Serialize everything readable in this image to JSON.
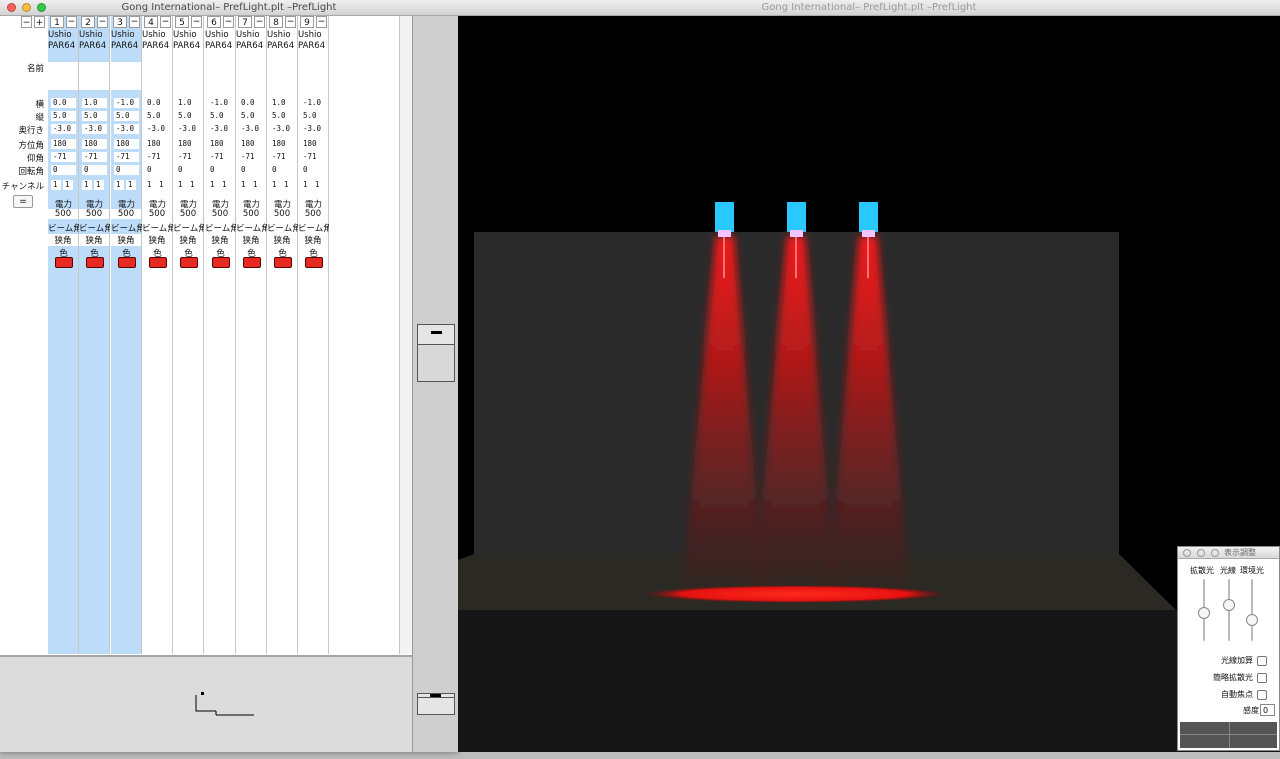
{
  "left_window": {
    "title": "Gong International– PrefLight.plt –PrefLight",
    "header_buttons": [
      "−",
      "+"
    ],
    "row_labels": [
      "名前",
      "横",
      "縦",
      "奥行き",
      "方位角",
      "仰角",
      "回転角",
      "チャンネル"
    ],
    "equal_button": "=",
    "power_label": "電力",
    "beam_label": "ビーム角",
    "narrow_label": "狭角",
    "color_label": "色",
    "fixtures": [
      {
        "num": "1",
        "brand": "Ushio",
        "model": "PAR64",
        "x": "0.0",
        "y": "5.0",
        "z": "-3.0",
        "azimuth": "180",
        "elevation": "-71",
        "rotation": "0",
        "channel": [
          "1",
          "1"
        ],
        "power": "500",
        "selected": true
      },
      {
        "num": "2",
        "brand": "Ushio",
        "model": "PAR64",
        "x": "1.0",
        "y": "5.0",
        "z": "-3.0",
        "azimuth": "180",
        "elevation": "-71",
        "rotation": "0",
        "channel": [
          "1",
          "1"
        ],
        "power": "500",
        "selected": true
      },
      {
        "num": "3",
        "brand": "Ushio",
        "model": "PAR64",
        "x": "-1.0",
        "y": "5.0",
        "z": "-3.0",
        "azimuth": "180",
        "elevation": "-71",
        "rotation": "0",
        "channel": [
          "1",
          "1"
        ],
        "power": "500",
        "selected": true
      },
      {
        "num": "4",
        "brand": "Ushio",
        "model": "PAR64",
        "x": "0.0",
        "y": "5.0",
        "z": "-3.0",
        "azimuth": "180",
        "elevation": "-71",
        "rotation": "0",
        "channel": [
          "1",
          "1"
        ],
        "power": "500",
        "selected": false
      },
      {
        "num": "5",
        "brand": "Ushio",
        "model": "PAR64",
        "x": "1.0",
        "y": "5.0",
        "z": "-3.0",
        "azimuth": "180",
        "elevation": "-71",
        "rotation": "0",
        "channel": [
          "1",
          "1"
        ],
        "power": "500",
        "selected": false
      },
      {
        "num": "6",
        "brand": "Ushio",
        "model": "PAR64",
        "x": "-1.0",
        "y": "5.0",
        "z": "-3.0",
        "azimuth": "180",
        "elevation": "-71",
        "rotation": "0",
        "channel": [
          "1",
          "1"
        ],
        "power": "500",
        "selected": false
      },
      {
        "num": "7",
        "brand": "Ushio",
        "model": "PAR64",
        "x": "0.0",
        "y": "5.0",
        "z": "-3.0",
        "azimuth": "180",
        "elevation": "-71",
        "rotation": "0",
        "channel": [
          "1",
          "1"
        ],
        "power": "500",
        "selected": false
      },
      {
        "num": "8",
        "brand": "Ushio",
        "model": "PAR64",
        "x": "1.0",
        "y": "5.0",
        "z": "-3.0",
        "azimuth": "180",
        "elevation": "-71",
        "rotation": "0",
        "channel": [
          "1",
          "1"
        ],
        "power": "500",
        "selected": false
      },
      {
        "num": "9",
        "brand": "Ushio",
        "model": "PAR64",
        "x": "-1.0",
        "y": "5.0",
        "z": "-3.0",
        "azimuth": "180",
        "elevation": "-71",
        "rotation": "0",
        "channel": [
          "1",
          "1"
        ],
        "power": "500",
        "selected": false
      }
    ],
    "fixture_color": "#e62a22"
  },
  "viewport_window": {
    "title": "Gong International– PrefLight.plt –PrefLight",
    "beam_color": "#ff1a1a",
    "fixture_head_color": "#29c8ff"
  },
  "display_panel": {
    "title": "表示調整",
    "slider_labels": [
      "拡散光",
      "光線",
      "環境光"
    ],
    "slider_levels": [
      0.45,
      0.6,
      0.3
    ],
    "options": [
      {
        "label": "光線加算",
        "checked": false
      },
      {
        "label": "簡略拡散光",
        "checked": false
      },
      {
        "label": "自動焦点",
        "checked": false
      }
    ],
    "sensitivity_label": "感度",
    "sensitivity_value": "0"
  }
}
